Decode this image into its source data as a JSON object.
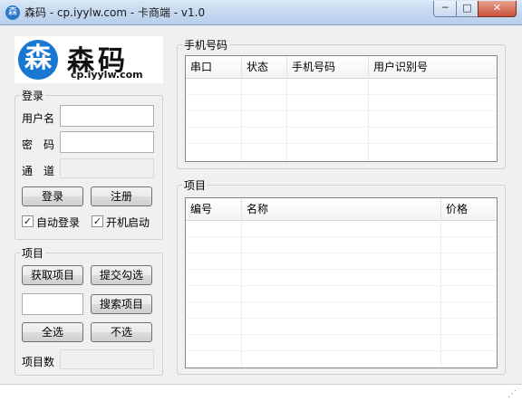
{
  "window": {
    "title": "森码 - cp.iyylw.com - 卡商端 - v1.0",
    "app_icon": "森"
  },
  "logo": {
    "glyph": "森",
    "name": "森码",
    "url": "cp.iyylw.com"
  },
  "login": {
    "group_title": "登录",
    "username_label": "用户名",
    "username_value": "",
    "password_label": "密　码",
    "password_value": "",
    "channel_label": "通　道",
    "channel_value": "",
    "login_button": "登录",
    "register_button": "注册",
    "auto_login_label": "自动登录",
    "auto_login_checked": true,
    "startup_label": "开机启动",
    "startup_checked": true
  },
  "projects_panel": {
    "group_title": "项目",
    "fetch_button": "获取项目",
    "submit_button": "提交勾选",
    "search_value": "",
    "search_button": "搜索项目",
    "select_all_button": "全选",
    "deselect_button": "不选",
    "count_label": "项目数",
    "count_value": ""
  },
  "phone_list": {
    "group_title": "手机号码",
    "columns": [
      "串口",
      "状态",
      "手机号码",
      "用户识别号"
    ]
  },
  "project_list": {
    "group_title": "项目",
    "columns": [
      "编号",
      "名称",
      "价格"
    ]
  },
  "colors": {
    "logo_blue": "#1877d1",
    "title_bar": "#c6d9f0",
    "close_red": "#c8533b"
  }
}
